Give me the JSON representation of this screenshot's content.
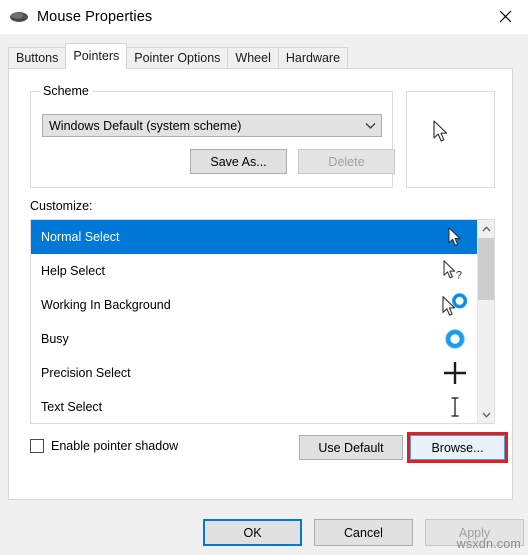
{
  "window": {
    "title": "Mouse Properties",
    "icon": "mouse-icon",
    "close_icon": "close-icon"
  },
  "tabs": [
    {
      "label": "Buttons",
      "active": false
    },
    {
      "label": "Pointers",
      "active": true
    },
    {
      "label": "Pointer Options",
      "active": false
    },
    {
      "label": "Wheel",
      "active": false
    },
    {
      "label": "Hardware",
      "active": false
    }
  ],
  "scheme": {
    "group_label": "Scheme",
    "dropdown_value": "Windows Default (system scheme)",
    "dropdown_icon": "chevron-down-icon",
    "save_as_label": "Save As...",
    "delete_label": "Delete",
    "delete_disabled": true
  },
  "preview": {
    "cursor_icon": "arrow-cursor-icon"
  },
  "customize": {
    "label": "Customize:",
    "rows": [
      {
        "label": "Normal Select",
        "icon": "arrow-cursor-icon",
        "selected": true
      },
      {
        "label": "Help Select",
        "icon": "arrow-question-cursor-icon",
        "selected": false
      },
      {
        "label": "Working In Background",
        "icon": "arrow-busy-ring-cursor-icon",
        "selected": false
      },
      {
        "label": "Busy",
        "icon": "busy-ring-cursor-icon",
        "selected": false
      },
      {
        "label": "Precision Select",
        "icon": "crosshair-cursor-icon",
        "selected": false
      },
      {
        "label": "Text Select",
        "icon": "ibeam-cursor-icon",
        "selected": false
      }
    ],
    "scroll_up_icon": "chevron-up-icon",
    "scroll_down_icon": "chevron-down-icon"
  },
  "options": {
    "pointer_shadow_label": "Enable pointer shadow",
    "pointer_shadow_checked": false,
    "use_default_label": "Use Default",
    "browse_label": "Browse...",
    "browse_highlighted": true
  },
  "footer": {
    "ok_label": "OK",
    "cancel_label": "Cancel",
    "apply_label": "Apply",
    "apply_disabled": true
  },
  "watermark": "wsxdn.com",
  "colors": {
    "accent": "#0078d7",
    "highlight_rect": "#e02020",
    "busy_ring": "#1a9cf0",
    "dialog_bg": "#f0f0f0"
  }
}
